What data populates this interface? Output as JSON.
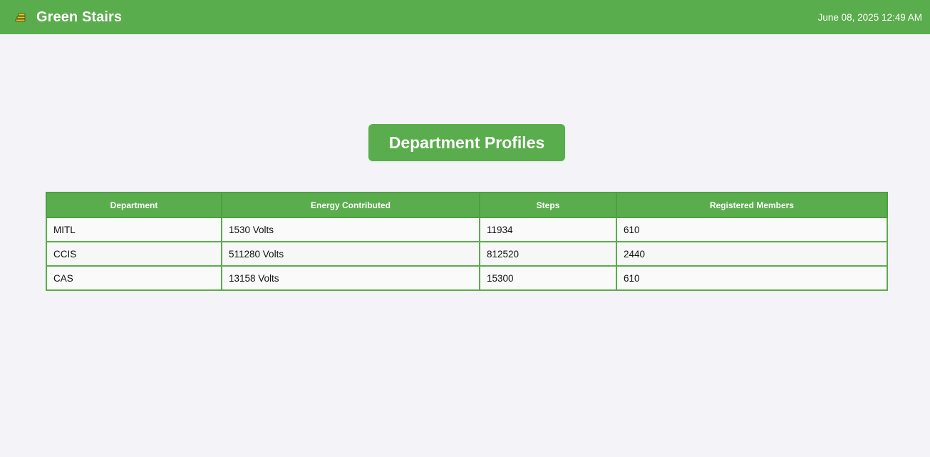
{
  "header": {
    "app_name": "Green Stairs",
    "logo_icon": "stairs-icon",
    "datetime": "June 08, 2025 12:49 AM"
  },
  "page": {
    "title": "Department Profiles"
  },
  "colors": {
    "accent": "#5aad4c",
    "background": "#f4f4f8"
  },
  "table": {
    "headers": [
      "Department",
      "Energy Contributed",
      "Steps",
      "Registered Members"
    ],
    "rows": [
      [
        "MITL",
        "1530 Volts",
        "11934",
        "610"
      ],
      [
        "CCIS",
        "511280 Volts",
        "812520",
        "2440"
      ],
      [
        "CAS",
        "13158 Volts",
        "15300",
        "610"
      ]
    ]
  }
}
